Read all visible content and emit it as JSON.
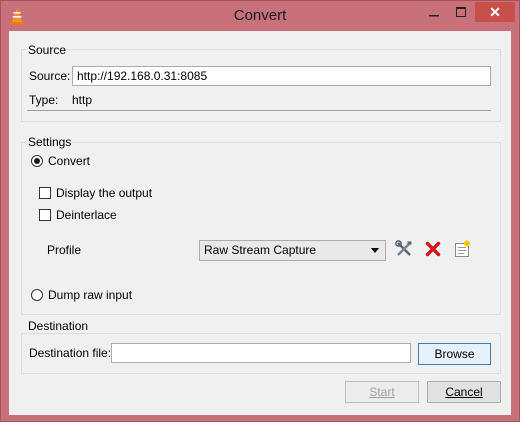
{
  "window": {
    "title": "Convert",
    "close_glyph": "✕"
  },
  "source": {
    "group_title": "Source",
    "source_label": "Source:",
    "source_value": "http://192.168.0.31:8085",
    "type_label": "Type:",
    "type_value": "http"
  },
  "settings": {
    "group_title": "Settings",
    "convert_label": "Convert",
    "convert_checked": true,
    "display_output_label": "Display the output",
    "deinterlace_label": "Deinterlace",
    "profile_label": "Profile",
    "profile_selected": "Raw Stream Capture",
    "dump_raw_label": "Dump raw input"
  },
  "destination": {
    "group_title": "Destination",
    "file_label": "Destination file:",
    "file_value": "",
    "browse_label": "Browse"
  },
  "footer": {
    "start_label": "Start",
    "cancel_label": "Cancel"
  },
  "icons": {
    "app": "vlc-cone-icon",
    "edit_profile": "wrench-screwdriver-icon",
    "delete_profile": "red-x-icon",
    "new_profile": "new-document-icon"
  },
  "colors": {
    "titlebar": "#c8717a",
    "close": "#c7504a",
    "client": "#f0f0f0"
  }
}
